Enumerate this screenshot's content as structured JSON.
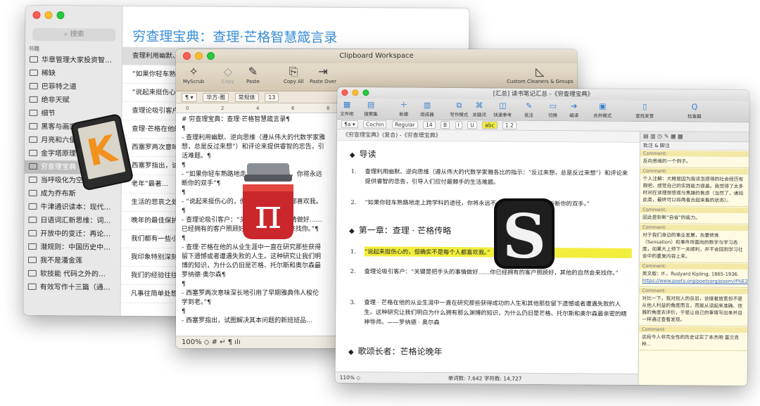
{
  "w1": {
    "search_placeholder": "搜索",
    "section_label": "书籍",
    "books": [
      "华章管理大家投资智…",
      "稀缺",
      "巴菲特之道",
      "绝非天赋",
      "细节",
      "黑客与画家",
      "月亮和六便士",
      "金字塔原理",
      "穷查理宝典",
      "当呼吸化为空气",
      "成为乔布斯",
      "牛津通识读本：现代…",
      "日语词汇新思维：词…",
      "开放中的变迁：再论…",
      "潜规则：中国历史中…",
      "我不是潘金莲",
      "软技能 代码之外的…",
      "有效写作十三篇（通…"
    ],
    "selected_index": 8,
    "title": "穷查理宝典：查理·芒格智慧箴言录",
    "quotes": [
      "查理利用幽默、逆向思维（遵从伟大的代数学家雅各比的指示：“反过来想，总是反过来想”）和…",
      "“如果你轻车熟路地走上跨学科的途径…",
      "“说起来挺伤心的…",
      "查理论吸引客户…",
      "查理·芒格在他的…",
      "西塞罗两次意味…",
      "西塞罗指出，试…",
      "老年”最著…",
      "生活的悲哀之处…",
      "晚年的最佳保护…",
      "我们都有一些小…",
      "我印象特别深刻…",
      "我们的经验往往…",
      "凡事往简单处想…"
    ]
  },
  "w2": {
    "window_title": "Clipboard Workspace",
    "toolbar": {
      "myscrub": "MyScrub",
      "copy": "Copy",
      "paste": "Paste",
      "copy_all": "Copy All",
      "paste_over": "Paste Over",
      "custom": "Custom Cleaners & Groups"
    },
    "format": {
      "style": "¶ ▾",
      "font": "华方-雅",
      "face": "常规体",
      "size": "13"
    },
    "ruler": [
      "0",
      "2",
      "4",
      "6",
      "8"
    ],
    "lines": [
      "# 穷查理宝典：查理·芒格智慧箴言录¶",
      "¶",
      "- 查理利用幽默、逆向思维（遵从伟大的代数学家雅",
      "想，总是反过来想”）和评论来提供睿智的忠告，引",
      "活难题。¶",
      "¶",
      "- “如果你轻车熟路地走上跨学科的途径，你将永远",
      "断你的双手”¶",
      "¶",
      "- “说起来挺伤心的，但确实不是每个人都喜欢我。",
      "¶",
      "- 查理论吸引客户：“关键是把手头的事情做好……",
      "已经拥有的客户照顾好，其他的自然会来找你。”¶",
      "¶",
      "- 查理·芒格在他的从业生涯中一直在研究那些获得",
      "留下遗憾或者遭遇失败的人生。这种研究让我们明",
      "博的知识，为什么仍旧是芒格、托尔斯和奥尔森最",
      "罗纳德·奥尔森¶",
      "¶",
      "- 西塞罗两次意味深长地引用了早期雅典伟人梭伦",
      "学到老。”¶",
      "¶",
      "- 西塞罗指出，试图解决其本问题的新班班品…"
    ],
    "status": "100% ◇  #  ↵  ¶  ılı"
  },
  "w3": {
    "window_title": "[汇总] 读书笔记汇总 -《穷查理宝典》",
    "toolbar": [
      "文件柜",
      "搜索集",
      "新建",
      "组成器",
      "写作模式",
      "关键词",
      "快速参考",
      "批注",
      "切换",
      "编译",
      "合并模式",
      "查找发音",
      "检查器"
    ],
    "format": {
      "style": "¶a ▾",
      "font": "Cochin",
      "face": "Regular",
      "size": "14",
      "spacing": "1.2"
    },
    "path": "《穷查理宝典》(复合) -《穷查理宝典》",
    "doc": {
      "h_intro": "导读",
      "intro_items": [
        "查理利用幽默、逆向思维（遵从伟大的代数学家雅各比的指示：“反过来想，总是反过来想”）和评论来提供睿智的忠告，引导人们应付最棘手的生活难题。",
        "“如果你轻车熟路地走上跨学科的途径，你将永远不会想回头。那就像是斩断你的双手。”"
      ],
      "h_ch1": "第一章：查理 · 芒格传略",
      "ch1_items": [
        "“说起来挺伤心的，但确实不是每个人都喜欢我。”",
        "查理论吸引客户：“关键是把手头的事情做好……你已经拥有的客户照顾好，其他的自然会来找你。”",
        "查理 · 芒格在他的从业生涯中一直在研究那些获得成功的人生和其他那些留下遗憾或者遭遇失败的人生。这种研究让我们明白为什么拥有那么渊博的知识，为什么仍旧是芒格、托尔斯和奥尔森最亲密的精神导师。——罗纳德 · 奥尔森"
      ],
      "h_ch2": "歌颂长者：芒格论晚年"
    },
    "status_zoom": "110% ◇",
    "status_wc": "单词数: 7,642   字符数: 14,727",
    "inspector_header": "批注 & 脚注",
    "comment_label": "Comment:",
    "comments": [
      "反向思维的一个例子。",
      "个人注解：大概是因为我读怎感得的社会经历有限吧，感觉自己的实践能力很差。我觉得了太多时间在读理想悲观与焦躁的焦虑（当然了，诸如此类，最终可以将两者合起来看的状态）。",
      "因此是斩断“自省”的能力。",
      "对于我们身边的事业发展，先要修炼（Sensation）和事件所面向的数字与学习态度，如果大上师下一关顺利，并不会回到学习社会中的重复内容上来。",
      "英文版：If-，Rudyard Kipling, 1865-1936.",
      "对比一下，我对别人的反驳，该接着放宽但不是从他人利益的角度而言，而是从读起来准确、信雅的角度去评价，于是让自己的事情写出来并且一样通过查看发现。",
      "这段今人非完全性的历史证实了本杰明·富兰克林..."
    ],
    "link": "https://www.poets.org/poetsorg/poem/if%E2%80%94",
    "colors": {
      "highlight": "#f2ee3d",
      "accent": "#3b8fd8"
    }
  },
  "icons": [
    "kindle-icon",
    "pilot-pi-icon",
    "scrivener-icon"
  ]
}
